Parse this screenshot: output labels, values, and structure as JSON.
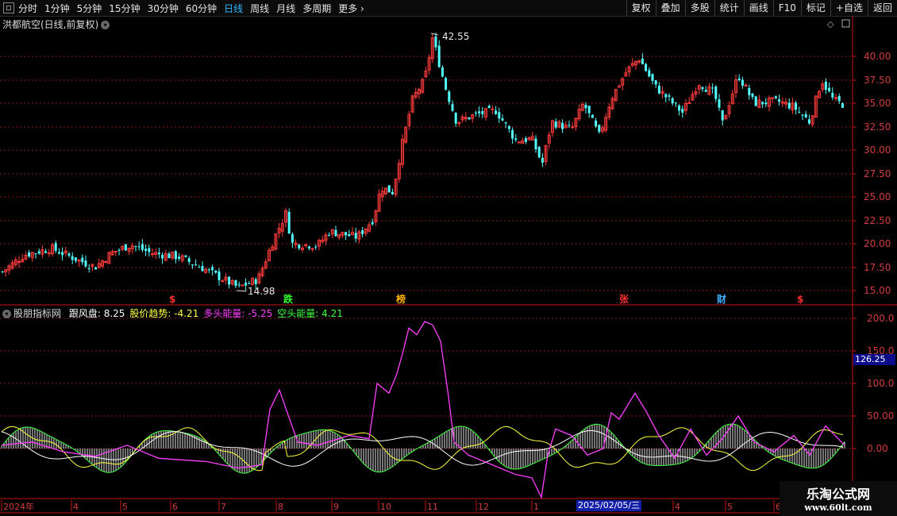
{
  "toolbar": {
    "periods": [
      "分时",
      "1分钟",
      "5分钟",
      "15分钟",
      "30分钟",
      "60分钟",
      "日线",
      "周线",
      "月线",
      "多周期",
      "更多"
    ],
    "active_period": "日线",
    "right_buttons": [
      "复权",
      "叠加",
      "多股",
      "统计",
      "画线",
      "F10",
      "标记",
      "+自选",
      "返回"
    ]
  },
  "main_chart": {
    "title": "洪都航空(日线,前复权)",
    "y_ticks": [
      "40.00",
      "37.50",
      "35.00",
      "32.50",
      "30.00",
      "27.50",
      "25.00",
      "22.50",
      "20.00",
      "17.50",
      "15.00"
    ],
    "high_label": "42.55",
    "low_label": "14.98",
    "event_markers": [
      {
        "text": "$",
        "color": "#ff3030"
      },
      {
        "text": "跌",
        "color": "#30ff30"
      },
      {
        "text": "榜",
        "color": "#ffb000"
      },
      {
        "text": "张",
        "color": "#ff3030"
      },
      {
        "text": "财",
        "color": "#40b0ff"
      },
      {
        "text": "$",
        "color": "#ff3030"
      }
    ]
  },
  "indicator": {
    "name": "股朋指标网",
    "items": [
      {
        "label": "跟风盘:",
        "value": "8.25",
        "color": "#ffffff"
      },
      {
        "label": "股价趋势:",
        "value": "-4.21",
        "color": "#ffff40"
      },
      {
        "label": "多头能量:",
        "value": "-5.25",
        "color": "#ff40ff"
      },
      {
        "label": "空头能量:",
        "value": "4.21",
        "color": "#40ff40"
      }
    ],
    "y_ticks": [
      "200.0",
      "150.0",
      "100.0",
      "50.00",
      "0.00"
    ],
    "current_value": "126.25"
  },
  "x_axis": {
    "labels": [
      "2024年",
      "4",
      "5",
      "6",
      "7",
      "8",
      "9",
      "10",
      "11",
      "12",
      "1",
      "4",
      "5",
      "6"
    ],
    "cursor_date": "2025/02/05/三"
  },
  "watermark": {
    "title": "乐淘公式网",
    "url": "www.60lt.com"
  },
  "chart_data": {
    "type": "candlestick",
    "price_range": [
      14.98,
      42.55
    ],
    "series": [
      {
        "name": "跟风盘",
        "value": 8.25
      },
      {
        "name": "股价趋势",
        "value": -4.21
      },
      {
        "name": "多头能量",
        "value": -5.25
      },
      {
        "name": "空头能量",
        "value": 4.21
      }
    ],
    "indicator_range": [
      -50,
      200
    ]
  }
}
